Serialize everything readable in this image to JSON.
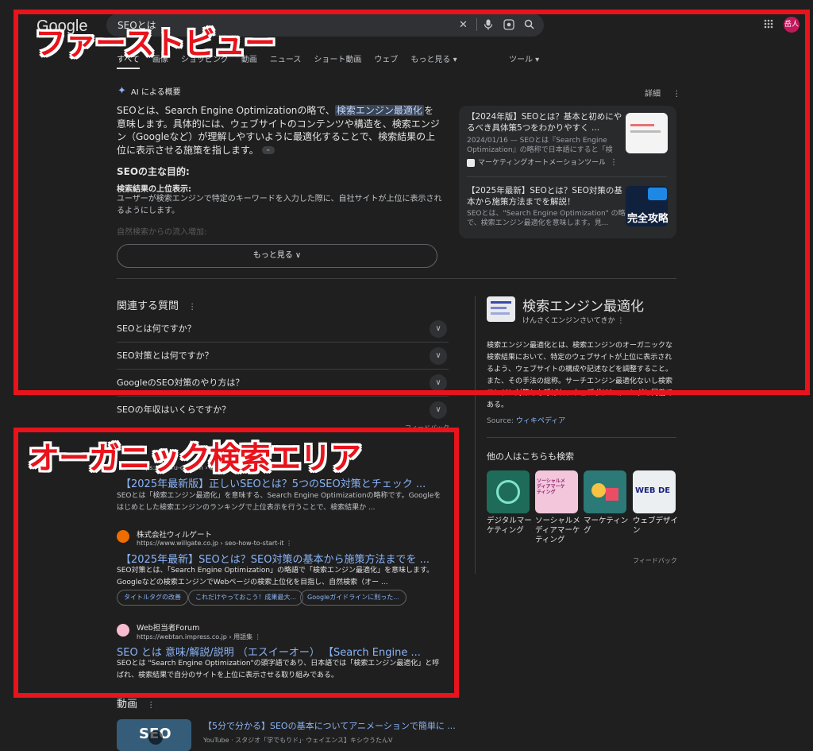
{
  "header": {
    "logo": "Google",
    "search_query": "SEOとは",
    "avatar_label": "岳人"
  },
  "tabs": [
    "すべて",
    "画像",
    "ショッピング",
    "動画",
    "ニュース",
    "ショート動画",
    "ウェブ",
    "もっと見る ▾"
  ],
  "tools_label": "ツール ▾",
  "ai_overview": {
    "heading": "AI による概要",
    "details_label": "詳細",
    "body_before": "SEOとは、Search Engine Optimizationの略で、",
    "body_highlight": "検索エンジン最適化",
    "body_after": "を意味します。具体的には、ウェブサイトのコンテンツや構造を、検索エンジン（Googleなど）が理解しやすいように最適化することで、検索結果の上位に表示させる施策を指します。",
    "subheading": "SEOの主な目的:",
    "point_title": "検索結果の上位表示:",
    "point_text": "ユーザーが検索エンジンで特定のキーワードを入力した際に、自社サイトが上位に表示されるようにします。",
    "faded_text": "自然検索からの流入増加:",
    "more_button": "もっと見る ∨",
    "sources": [
      {
        "title": "【2024年版】SEOとは？基本と初めにやるべき具体策5つをわかりやすく ...",
        "meta": "2024/01/16 — SEOとは『Search Engine Optimization』の略称で日本語にすると「検索...",
        "site": "マーケティングオートメーションツール SA..."
      },
      {
        "title": "【2025年最新】SEOとは？SEO対策の基本から施策方法までを解説！",
        "meta": "SEOとは、\"Search Engine Optimization\" の略で、検索エンジン最適化を意味します。見..."
      }
    ],
    "thumb2_text": "完全攻略"
  },
  "related": {
    "title": "関連する質問",
    "questions": [
      "SEOとは何ですか？",
      "SEO対策とは何ですか？",
      "GoogleのSEO対策のやり方は？",
      "SEOの年収はいくらですか？"
    ]
  },
  "knowledge_panel": {
    "title": "検索エンジン最適化",
    "reading": "けんさくエンジンさいてきか",
    "description": "検索エンジン最適化とは、検索エンジンのオーガニックな検索結果において、特定のウェブサイトが上位に表示されるよう、ウェブサイトの構成や記述などを調整すること。また、その手法の総称。サーチエンジン最適化ないし検索エンジン対策とも呼ばれ、ウェブポジショニングと同義である。",
    "source_label": "Source: ",
    "source_link": "ウィキペディア",
    "others_title": "他の人はこちらも検索",
    "others": [
      "デジタルマーケティング",
      "ソーシャルメディアマーケティング",
      "マーケティング",
      "ウェブデザイン"
    ],
    "other_thumb_texts": [
      "",
      "ソーシャルメディアマーケティング",
      "",
      "WEB DE"
    ],
    "feedback": "フィードバック"
  },
  "results": [
    {
      "site": "",
      "url": "https://mieru-ca.com › blog › seo-m...",
      "title": "【2025年最新版】正しいSEOとは？5つのSEO対策とチェック ...",
      "snippet": "SEOとは「検索エンジン最適化」を意味する、Search Engine Optimizationの略称です。Googleをはじめとした検索エンジンのランキングで上位表示を行うことで、検索結果か ..."
    },
    {
      "site": "株式会社ウィルゲート",
      "url": "https://www.willgate.co.jp › seo-how-to-start-it",
      "title": "【2025年最新】SEOとは？SEO対策の基本から施策方法までを ...",
      "snippet": "SEO対策とは、「Search Engine Optimization」の略語で「検索エンジン最適化」を意味します。Googleなどの検索エンジンでWebページの検索上位化を目指し、自然検索（オー ...",
      "chips": [
        "タイトルタグの改善",
        "これだけやっておこう！成果最大...",
        "Googleガイドラインに則った..."
      ]
    },
    {
      "site": "Web担当者Forum",
      "url": "https://webtan.impress.co.jp › 用語集",
      "title": "SEO とは 意味/解説/説明 （エスイーオー） 【Search Engine ...",
      "snippet": "SEOとは \"Search Engine Optimization\"の頭字語であり、日本語では「検索エンジン最適化」と呼ばれ、検索結果で自分のサイトを上位に表示させる取り組みである。"
    }
  ],
  "feedback_small": "フィードバック",
  "videos": {
    "heading": "動画",
    "thumb_text": "SEO",
    "title": "【5分で分かる】SEOの基本についてアニメーションで簡単に ...",
    "meta": "YouTube · スタジオ「学でもりド」· ウェイエンス】キシウうたんV"
  },
  "annotations": {
    "first_view": "ファーストビュー",
    "organic": "オーガニック検索エリア"
  },
  "colors": {
    "background": "#1f1f1f",
    "link": "#8ab4f8",
    "annotation_red": "#e8131b"
  }
}
